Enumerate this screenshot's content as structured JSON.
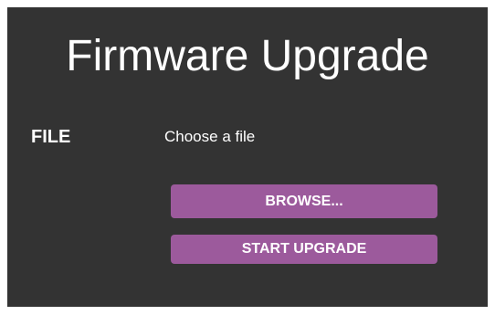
{
  "page": {
    "title": "Firmware Upgrade"
  },
  "file": {
    "label": "FILE",
    "value": "Choose a file"
  },
  "actions": {
    "browse_label": "BROWSE...",
    "start_upgrade_label": "START UPGRADE"
  },
  "colors": {
    "panel_background": "#333333",
    "button_background": "#9c5a9c",
    "text": "#ffffff"
  }
}
